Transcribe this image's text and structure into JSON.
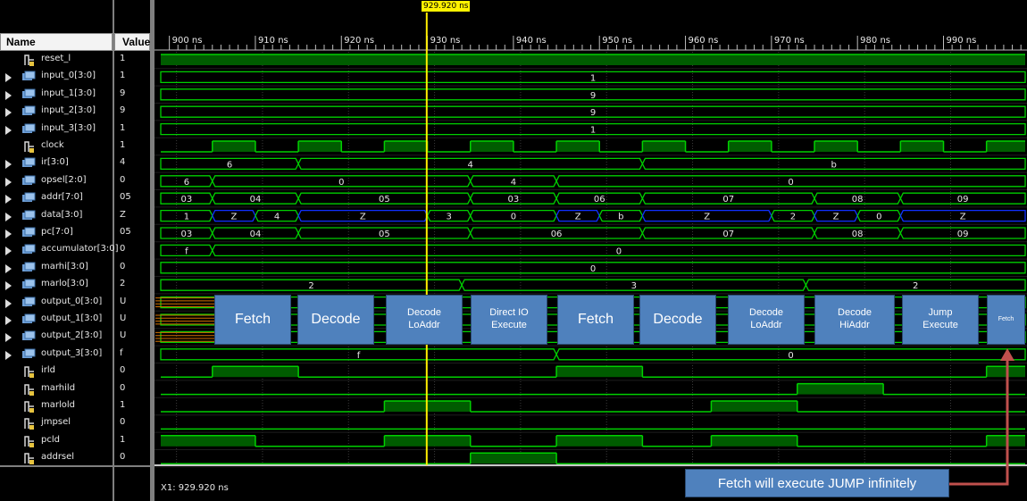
{
  "columns": {
    "name": "Name",
    "value": "Value"
  },
  "cursor": {
    "label": "929.920 ns",
    "time_ns": 929.92
  },
  "status": "X1: 929.920 ns",
  "timeline": {
    "start_ns": 899.0,
    "end_ns": 999.5,
    "ticks": [
      {
        "t": 900,
        "label": "900 ns"
      },
      {
        "t": 910,
        "label": "910 ns"
      },
      {
        "t": 920,
        "label": "920 ns"
      },
      {
        "t": 930,
        "label": "930 ns"
      },
      {
        "t": 940,
        "label": "940 ns"
      },
      {
        "t": 950,
        "label": "950 ns"
      },
      {
        "t": 960,
        "label": "960 ns"
      },
      {
        "t": 970,
        "label": "970 ns"
      },
      {
        "t": 980,
        "label": "980 ns"
      },
      {
        "t": 990,
        "label": "990 ns"
      }
    ]
  },
  "signals": [
    {
      "name": "reset_l",
      "value": "1",
      "kind": "bit",
      "expand": false,
      "edges": [
        [
          899,
          1
        ]
      ]
    },
    {
      "name": "input_0[3:0]",
      "value": "1",
      "kind": "bus",
      "expand": true,
      "segs": [
        [
          899,
          999.5,
          "1"
        ]
      ]
    },
    {
      "name": "input_1[3:0]",
      "value": "9",
      "kind": "bus",
      "expand": true,
      "segs": [
        [
          899,
          999.5,
          "9"
        ]
      ]
    },
    {
      "name": "input_2[3:0]",
      "value": "9",
      "kind": "bus",
      "expand": true,
      "segs": [
        [
          899,
          999.5,
          "9"
        ]
      ]
    },
    {
      "name": "input_3[3:0]",
      "value": "1",
      "kind": "bus",
      "expand": true,
      "segs": [
        [
          899,
          999.5,
          "1"
        ]
      ]
    },
    {
      "name": "clock",
      "value": "1",
      "kind": "bit",
      "expand": false,
      "edges": [
        [
          899,
          0
        ],
        [
          905,
          1
        ],
        [
          910,
          0
        ],
        [
          915,
          1
        ],
        [
          920,
          0
        ],
        [
          925,
          1
        ],
        [
          930,
          0
        ],
        [
          935,
          1
        ],
        [
          940,
          0
        ],
        [
          945,
          1
        ],
        [
          950,
          0
        ],
        [
          955,
          1
        ],
        [
          960,
          0
        ],
        [
          965,
          1
        ],
        [
          970,
          0
        ],
        [
          975,
          1
        ],
        [
          980,
          0
        ],
        [
          985,
          1
        ],
        [
          990,
          0
        ],
        [
          995,
          1
        ]
      ]
    },
    {
      "name": "ir[3:0]",
      "value": "4",
      "kind": "bus",
      "expand": true,
      "segs": [
        [
          899,
          915,
          "6"
        ],
        [
          915,
          955,
          "4"
        ],
        [
          955,
          999.5,
          "b"
        ]
      ]
    },
    {
      "name": "opsel[2:0]",
      "value": "0",
      "kind": "bus",
      "expand": true,
      "segs": [
        [
          899,
          905,
          "6"
        ],
        [
          905,
          935,
          "0"
        ],
        [
          935,
          945,
          "4"
        ],
        [
          945,
          999.5,
          "0"
        ]
      ]
    },
    {
      "name": "addr[7:0]",
      "value": "05",
      "kind": "bus",
      "expand": true,
      "segs": [
        [
          899,
          905,
          "03"
        ],
        [
          905,
          915,
          "04"
        ],
        [
          915,
          935,
          "05"
        ],
        [
          935,
          945,
          "03"
        ],
        [
          945,
          955,
          "06"
        ],
        [
          955,
          975,
          "07"
        ],
        [
          975,
          985,
          "08"
        ],
        [
          985,
          999.5,
          "09"
        ]
      ]
    },
    {
      "name": "data[3:0]",
      "value": "Z",
      "kind": "bus",
      "expand": true,
      "segs": [
        [
          899,
          905,
          "1"
        ],
        [
          905,
          910,
          "Z"
        ],
        [
          910,
          915,
          "4"
        ],
        [
          915,
          930,
          "Z"
        ],
        [
          930,
          935,
          "3"
        ],
        [
          935,
          945,
          "0"
        ],
        [
          945,
          950,
          "Z"
        ],
        [
          950,
          955,
          "b"
        ],
        [
          955,
          970,
          "Z"
        ],
        [
          970,
          975,
          "2"
        ],
        [
          975,
          980,
          "Z"
        ],
        [
          980,
          985,
          "0"
        ],
        [
          985,
          999.5,
          "Z"
        ]
      ],
      "z_values": [
        "Z"
      ]
    },
    {
      "name": "pc[7:0]",
      "value": "05",
      "kind": "bus",
      "expand": true,
      "segs": [
        [
          899,
          905,
          "03"
        ],
        [
          905,
          915,
          "04"
        ],
        [
          915,
          935,
          "05"
        ],
        [
          935,
          955,
          "06"
        ],
        [
          955,
          975,
          "07"
        ],
        [
          975,
          985,
          "08"
        ],
        [
          985,
          999.5,
          "09"
        ]
      ]
    },
    {
      "name": "accumulator[3:0]",
      "value": "0",
      "kind": "bus",
      "expand": true,
      "segs": [
        [
          899,
          905,
          "f"
        ],
        [
          905,
          999.5,
          "0"
        ]
      ]
    },
    {
      "name": "marhi[3:0]",
      "value": "0",
      "kind": "bus",
      "expand": true,
      "segs": [
        [
          899,
          999.5,
          "0"
        ]
      ]
    },
    {
      "name": "marlo[3:0]",
      "value": "2",
      "kind": "bus",
      "expand": true,
      "segs": [
        [
          899,
          934,
          "2"
        ],
        [
          934,
          974,
          "3"
        ],
        [
          974,
          999.5,
          "2"
        ]
      ]
    },
    {
      "name": "output_0[3:0]",
      "value": "U",
      "kind": "bus",
      "expand": true,
      "segs": [
        [
          899,
          999.5,
          ""
        ]
      ],
      "undef_until": 905
    },
    {
      "name": "output_1[3:0]",
      "value": "U",
      "kind": "bus",
      "expand": true,
      "segs": [
        [
          899,
          999.5,
          ""
        ]
      ],
      "undef_until": 905
    },
    {
      "name": "output_2[3:0]",
      "value": "U",
      "kind": "bus",
      "expand": true,
      "segs": [
        [
          899,
          999.5,
          ""
        ]
      ],
      "undef_until": 905
    },
    {
      "name": "output_3[3:0]",
      "value": "f",
      "kind": "bus",
      "expand": true,
      "segs": [
        [
          899,
          945,
          "f"
        ],
        [
          945,
          999.5,
          "0"
        ]
      ]
    },
    {
      "name": "irld",
      "value": "0",
      "kind": "bit",
      "expand": false,
      "edges": [
        [
          899,
          0
        ],
        [
          905,
          1
        ],
        [
          915,
          0
        ],
        [
          945,
          1
        ],
        [
          955,
          0
        ],
        [
          995,
          1
        ]
      ]
    },
    {
      "name": "marhild",
      "value": "0",
      "kind": "bit",
      "expand": false,
      "edges": [
        [
          899,
          0
        ],
        [
          973,
          1
        ],
        [
          983,
          0
        ]
      ]
    },
    {
      "name": "marlold",
      "value": "1",
      "kind": "bit",
      "expand": false,
      "edges": [
        [
          899,
          0
        ],
        [
          925,
          1
        ],
        [
          935,
          0
        ],
        [
          963,
          1
        ],
        [
          973,
          0
        ]
      ]
    },
    {
      "name": "jmpsel",
      "value": "0",
      "kind": "bit",
      "expand": false,
      "edges": [
        [
          899,
          0
        ]
      ]
    },
    {
      "name": "pcld",
      "value": "1",
      "kind": "bit",
      "expand": false,
      "edges": [
        [
          899,
          1
        ],
        [
          910,
          0
        ],
        [
          925,
          1
        ],
        [
          935,
          0
        ],
        [
          945,
          1
        ],
        [
          955,
          0
        ],
        [
          963,
          1
        ],
        [
          973,
          0
        ],
        [
          995,
          1
        ]
      ]
    },
    {
      "name": "addrsel",
      "value": "0",
      "kind": "bit",
      "expand": false,
      "edges": [
        [
          899,
          0
        ],
        [
          935,
          1
        ],
        [
          945,
          0
        ]
      ]
    }
  ],
  "annotations": [
    {
      "text": "Fetch",
      "size": "big"
    },
    {
      "text": "Decode",
      "size": "big"
    },
    {
      "text": "Decode\nLoAddr",
      "size": "small"
    },
    {
      "text": "Direct IO\nExecute",
      "size": "small"
    },
    {
      "text": "Fetch",
      "size": "big"
    },
    {
      "text": "Decode",
      "size": "big"
    },
    {
      "text": "Decode\nLoAddr",
      "size": "small"
    },
    {
      "text": "Decode\nHiAddr",
      "size": "small"
    },
    {
      "text": "Jump\nExecute",
      "size": "small"
    },
    {
      "text": "Fetch",
      "size": "tiny"
    }
  ],
  "note": "Fetch will execute JUMP infinitely",
  "colors": {
    "wave": "#00d000",
    "wave_fill": "#005c00",
    "bus_z": "#1030ff",
    "cursor": "#ffee00",
    "undefined": "#d07000",
    "arrow": "#c0504d",
    "grid": "#3a3a3a"
  }
}
